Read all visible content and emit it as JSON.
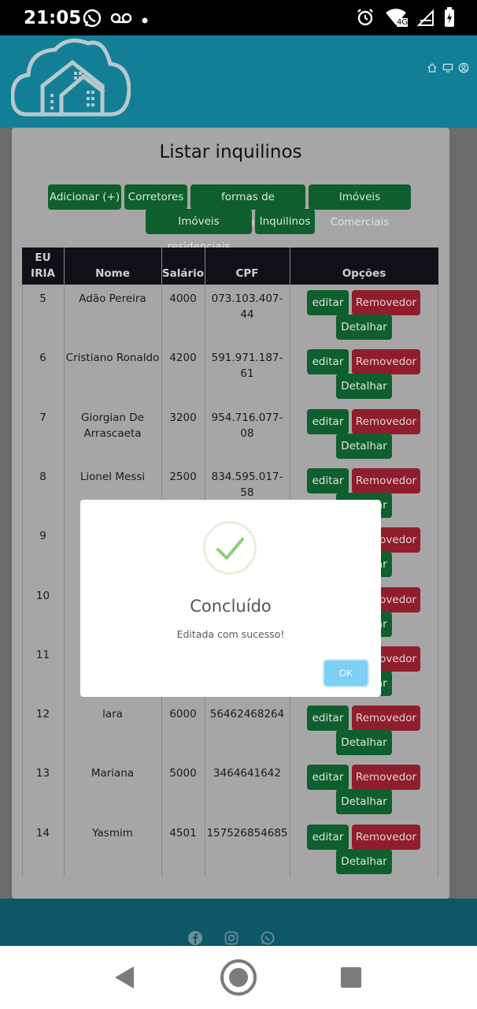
{
  "status_bar": {
    "time": "21:05",
    "network": "4G"
  },
  "page": {
    "title": "Listar inquilinos"
  },
  "nav_buttons": [
    {
      "label": "Adicionar (+)"
    },
    {
      "label": "Corretores"
    },
    {
      "label": "formas de pagamento"
    },
    {
      "label": "Imóveis Comerciais"
    },
    {
      "label": "Imóveis residenciais"
    },
    {
      "label": "Inquilinos"
    }
  ],
  "table": {
    "headers": {
      "id_line1": "EU",
      "id_line2": "IRIA",
      "nome": "Nome",
      "salario": "Salário",
      "cpf": "CPF",
      "opcoes": "Opções"
    },
    "rows": [
      {
        "id": "5",
        "nome_l1": "Adão Pereira",
        "nome_l2": "",
        "salario": "4000",
        "cpf_l1": "073.103.407-",
        "cpf_l2": "44"
      },
      {
        "id": "6",
        "nome_l1": "Cristiano Ronaldo",
        "nome_l2": "",
        "salario": "4200",
        "cpf_l1": "591.971.187-",
        "cpf_l2": "61"
      },
      {
        "id": "7",
        "nome_l1": "Giorgian De",
        "nome_l2": "Arrascaeta",
        "salario": "3200",
        "cpf_l1": "954.716.077-",
        "cpf_l2": "08"
      },
      {
        "id": "8",
        "nome_l1": "Lionel Messi",
        "nome_l2": "",
        "salario": "2500",
        "cpf_l1": "834.595.017-",
        "cpf_l2": "58"
      },
      {
        "id": "9",
        "nome_l1": "",
        "nome_l2": "",
        "salario": "",
        "cpf_l1": "",
        "cpf_l2": ""
      },
      {
        "id": "10",
        "nome_l1": "",
        "nome_l2": "",
        "salario": "",
        "cpf_l1": "",
        "cpf_l2": ""
      },
      {
        "id": "11",
        "nome_l1": "",
        "nome_l2": "",
        "salario": "",
        "cpf_l1": "",
        "cpf_l2": ""
      },
      {
        "id": "12",
        "nome_l1": "lara",
        "nome_l2": "",
        "salario": "6000",
        "cpf_l1": "56462468264",
        "cpf_l2": ""
      },
      {
        "id": "13",
        "nome_l1": "Mariana",
        "nome_l2": "",
        "salario": "5000",
        "cpf_l1": "3464641642",
        "cpf_l2": ""
      },
      {
        "id": "14",
        "nome_l1": "Yasmim",
        "nome_l2": "",
        "salario": "4501",
        "cpf_l1": "157526854685",
        "cpf_l2": ""
      }
    ],
    "actions": {
      "edit": "editar",
      "remove": "Removedor",
      "detail": "Detalhar"
    }
  },
  "modal": {
    "title": "Concluído",
    "message": "Editada com sucesso!",
    "ok_label": "OK"
  },
  "colors": {
    "header": "#137f97",
    "success": "#8ccf73",
    "ok_button": "#7ecff4"
  }
}
